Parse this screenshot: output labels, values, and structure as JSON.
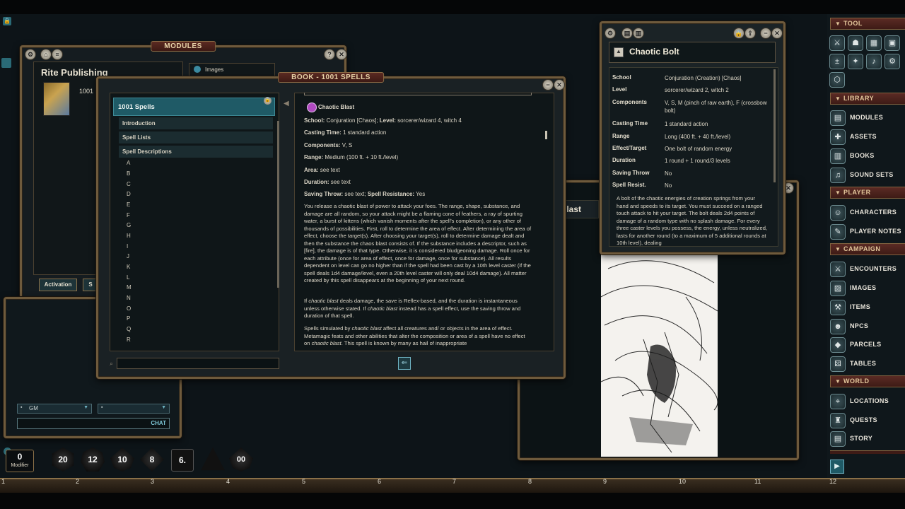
{
  "top_lock": "🔒",
  "modules_window": {
    "title": "MODULES",
    "publisher": "Rite Publishing",
    "module_label": "1001 S",
    "filter_tab": "Images",
    "activation_button": "Activation",
    "second_button": "S"
  },
  "chat": {
    "identity_select": "GM",
    "emote_select": "",
    "chat_label": "CHAT"
  },
  "book_window": {
    "title": "BOOK - 1001 SPELLS",
    "selected": "1001 Spells",
    "entries": [
      "Introduction",
      "Spell Lists",
      "Spell Descriptions"
    ],
    "letters": [
      "A",
      "B",
      "C",
      "D",
      "E",
      "F",
      "G",
      "H",
      "I",
      "J",
      "K",
      "L",
      "M",
      "N",
      "O",
      "P",
      "Q",
      "R"
    ],
    "search_placeholder": "",
    "spell": {
      "name": "Chaotic Blast",
      "school_label": "School:",
      "school": "Conjuration [Chaos];",
      "level_label": "Level:",
      "level": "sorcerer/wizard 4, witch 4",
      "casting_label": "Casting Time:",
      "casting": "1 standard action",
      "components_label": "Components:",
      "components": "V, S",
      "range_label": "Range:",
      "range": "Medium (100 ft. + 10 ft./level)",
      "area_label": "Area:",
      "area": "see text",
      "duration_label": "Duration:",
      "duration": "see text",
      "saving_label": "Saving Throw:",
      "saving": "see text;",
      "sr_label": "Spell Resistance:",
      "sr": "Yes",
      "para1": "You release a chaotic blast of power to attack your foes. The range, shape, substance, and damage are all random, so your attack might be a flaming cone of feathers, a ray of spurting water, a burst of kittens (which vanish moments after the spell's completion), or any other of thousands of possibilities. First, roll to determine the area of effect. After determining the area of effect, choose the target(s). After choosing your target(s), roll to determine damage dealt and then the substance the chaos blast consists of. If the substance includes a descriptor, such as [fire], the damage is of that type. Otherwise, it is considered bludgeoning damage. Roll once for each attribute (once for area of effect, once for damage, once for substance). All results dependent on level can go no higher than if the spell had been cast by a 10th level caster (if the spell deals 1d4 damage/level, even a 20th level caster will only deal 10d4 damage). All matter created by this spell disappears at the beginning of your next round.",
      "para2_a": "If ",
      "para2_i1": "chaotic blast",
      "para2_b": " deals damage, the save is Reflex-based, and the duration is instantaneous unless otherwise stated. If ",
      "para2_i2": "chaotic blast",
      "para2_c": " instead has a spell effect, use the saving throw and duration of that spell.",
      "para3_a": "Spells simulated by ",
      "para3_i1": "chaotic blast",
      "para3_b": " affect all creatures and/ or objects in the area of effect. Metamagic feats and other abilities that alter the composition or area of a spell have no effect on ",
      "para3_i2": "chaotic blast",
      "para3_c": ". This spell is known by many as hail of inappropriate"
    }
  },
  "bolt_window": {
    "title": "Chaotic Bolt",
    "rows": [
      {
        "label": "School",
        "value": "Conjuration (Creation) [Chaos]"
      },
      {
        "label": "Level",
        "value": "sorcerer/wizard 2, witch 2"
      },
      {
        "label": "Components",
        "value": "V, S, M (pinch of raw earth), F (crossbow bolt)"
      },
      {
        "label": "Casting Time",
        "value": "1 standard action"
      },
      {
        "label": "Range",
        "value": "Long (400 ft. + 40 ft./level)"
      },
      {
        "label": "Effect/Target",
        "value": "One bolt of random energy"
      },
      {
        "label": "Duration",
        "value": "1 round + 1 round/3 levels"
      },
      {
        "label": "Saving Throw",
        "value": "No"
      },
      {
        "label": "Spell Resist.",
        "value": "No"
      }
    ],
    "description": "A bolt of the chaotic energies of creation springs from your hand and speeds to its target. You must succeed on a ranged touch attack to hit your target. The bolt deals 2d4 points of damage of a random type with no splash damage. For every three caster levels you possess, the energy, unless neutralized, lasts for another round (to a maximum of 5 additional rounds at 10th level), dealing"
  },
  "image_window": {
    "partial_title": "otic Blast"
  },
  "sidebar": {
    "tool_header": "TOOL",
    "library_header": "LIBRARY",
    "library": [
      "MODULES",
      "ASSETS",
      "BOOKS",
      "SOUND SETS"
    ],
    "player_header": "PLAYER",
    "player": [
      "CHARACTERS",
      "PLAYER NOTES"
    ],
    "campaign_header": "CAMPAIGN",
    "campaign": [
      "ENCOUNTERS",
      "IMAGES",
      "ITEMS",
      "NPCS",
      "PARCELS",
      "TABLES"
    ],
    "world_header": "WORLD",
    "world": [
      "LOCATIONS",
      "QUESTS",
      "STORY"
    ]
  },
  "modifier": {
    "value": "0",
    "label": "Modifier"
  },
  "dice": [
    "20",
    "12",
    "10",
    "8",
    "6.",
    "",
    "00"
  ],
  "ruler": [
    "1",
    "2",
    "3",
    "4",
    "5",
    "6",
    "7",
    "8",
    "9",
    "10",
    "11",
    "12"
  ]
}
